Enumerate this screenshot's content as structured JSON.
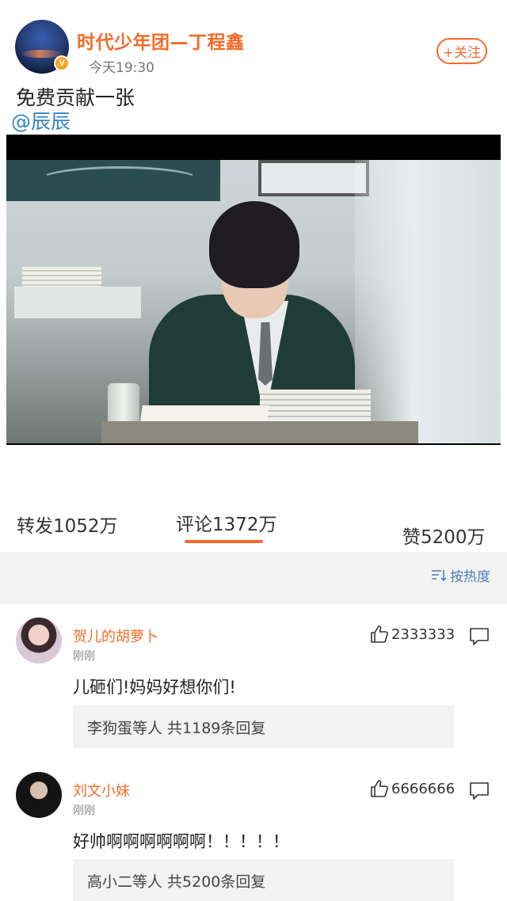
{
  "post": {
    "user_name": "时代少年团—丁程鑫",
    "verified_badge": "V",
    "time": "今天19:30",
    "follow_label": "+关注",
    "text": "免费贡献一张",
    "mention": "@辰辰"
  },
  "stats": {
    "repost": "转发1052万",
    "comments": "评论1372万",
    "likes": "赞5200万"
  },
  "sort": {
    "label": "按热度",
    "icon": "sort-icon"
  },
  "comments": [
    {
      "name": "贺儿的胡萝卜",
      "time": "刚刚",
      "likes": "2333333",
      "text": "儿砸们!妈妈好想你们!",
      "replies": "李狗蛋等人 共1189条回复"
    },
    {
      "name": "刘文小妹",
      "time": "刚刚",
      "likes": "6666666",
      "text": "好帅啊啊啊啊啊啊！！！！！",
      "replies": "高小二等人 共5200条回复"
    }
  ],
  "colors": {
    "accent": "#f26b2b",
    "link": "#3384c6",
    "sort_link": "#4a7fb5"
  }
}
